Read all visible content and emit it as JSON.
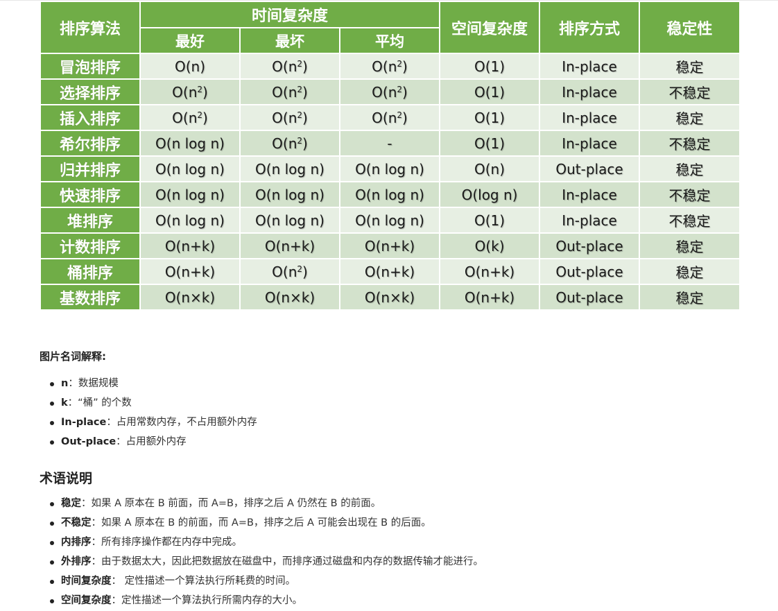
{
  "table": {
    "headers": {
      "algo": "排序算法",
      "time": "时间复杂度",
      "best": "最好",
      "worst": "最坏",
      "avg": "平均",
      "space": "空间复杂度",
      "mode": "排序方式",
      "stable": "稳定性"
    },
    "rows": [
      {
        "name": "冒泡排序",
        "best": "O(n)",
        "worst": "O(n²)",
        "avg": "O(n²)",
        "space": "O(1)",
        "mode": "In-place",
        "stable": "稳定"
      },
      {
        "name": "选择排序",
        "best": "O(n²)",
        "worst": "O(n²)",
        "avg": "O(n²)",
        "space": "O(1)",
        "mode": "In-place",
        "stable": "不稳定"
      },
      {
        "name": "插入排序",
        "best": "O(n²)",
        "worst": "O(n²)",
        "avg": "O(n²)",
        "space": "O(1)",
        "mode": "In-place",
        "stable": "稳定"
      },
      {
        "name": "希尔排序",
        "best": "O(n log n)",
        "worst": "O(n²)",
        "avg": "-",
        "space": "O(1)",
        "mode": "In-place",
        "stable": "不稳定"
      },
      {
        "name": "归并排序",
        "best": "O(n log n)",
        "worst": "O(n log n)",
        "avg": "O(n log n)",
        "space": "O(n)",
        "mode": "Out-place",
        "stable": "稳定"
      },
      {
        "name": "快速排序",
        "best": "O(n log n)",
        "worst": "O(n log n)",
        "avg": "O(n log n)",
        "space": "O(log n)",
        "mode": "In-place",
        "stable": "不稳定"
      },
      {
        "name": "堆排序",
        "best": "O(n log n)",
        "worst": "O(n log n)",
        "avg": "O(n log n)",
        "space": "O(1)",
        "mode": "In-place",
        "stable": "不稳定"
      },
      {
        "name": "计数排序",
        "best": "O(n+k)",
        "worst": "O(n+k)",
        "avg": "O(n+k)",
        "space": "O(k)",
        "mode": "Out-place",
        "stable": "稳定"
      },
      {
        "name": "桶排序",
        "best": "O(n+k)",
        "worst": "O(n²)",
        "avg": "O(n+k)",
        "space": "O(n+k)",
        "mode": "Out-place",
        "stable": "稳定"
      },
      {
        "name": "基数排序",
        "best": "O(n×k)",
        "worst": "O(n×k)",
        "avg": "O(n×k)",
        "space": "O(n+k)",
        "mode": "Out-place",
        "stable": "稳定"
      }
    ]
  },
  "glossary": {
    "title": "图片名词解释:",
    "items": [
      {
        "term": "n",
        "sep": "：",
        "desc": "数据规模"
      },
      {
        "term": "k",
        "sep": "：",
        "desc": "“桶” 的个数"
      },
      {
        "term": "In-place",
        "sep": "：",
        "desc": "占用常数内存，不占用额外内存"
      },
      {
        "term": "Out-place",
        "sep": "：",
        "desc": "占用额外内存"
      }
    ]
  },
  "terms": {
    "title": "术语说明",
    "items": [
      {
        "term": "稳定",
        "sep": "：",
        "desc": "如果 A 原本在 B 前面，而 A=B，排序之后 A 仍然在 B 的前面。"
      },
      {
        "term": "不稳定",
        "sep": "：",
        "desc": "如果 A 原本在 B 的前面，而 A=B，排序之后 A 可能会出现在 B 的后面。"
      },
      {
        "term": "内排序",
        "sep": "：",
        "desc": "所有排序操作都在内存中完成。"
      },
      {
        "term": "外排序",
        "sep": "：",
        "desc": "由于数据太大，因此把数据放在磁盘中，而排序通过磁盘和内存的数据传输才能进行。"
      },
      {
        "term": "时间复杂度",
        "sep": "：",
        "desc": " 定性描述一个算法执行所耗费的时间。"
      },
      {
        "term": "空间复杂度",
        "sep": "：",
        "desc": "定性描述一个算法执行所需内存的大小。"
      }
    ]
  }
}
